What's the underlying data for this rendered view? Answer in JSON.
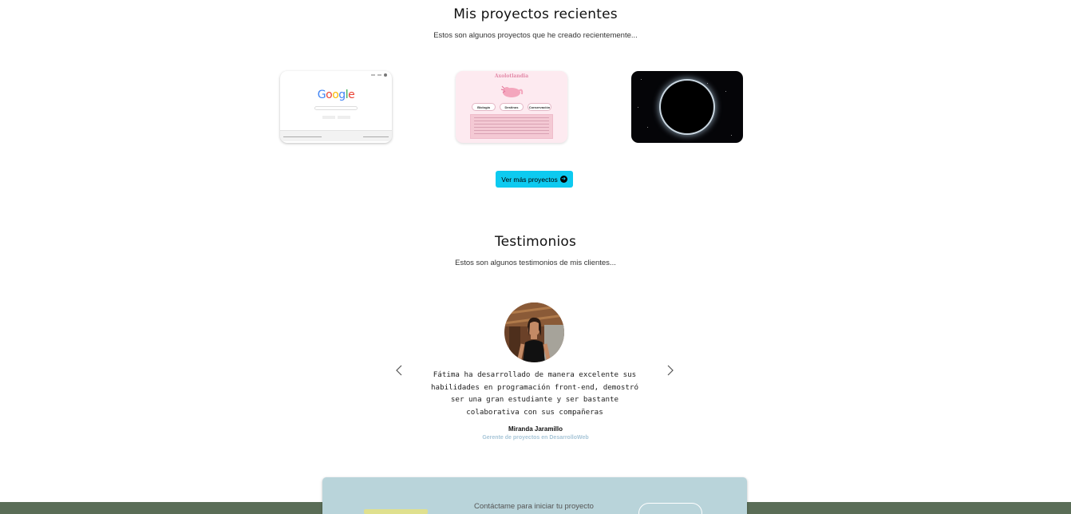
{
  "projects": {
    "title": "Mis proyectos recientes",
    "subtitle": "Estos son algunos proyectos que he creado recientemente...",
    "cards": [
      {
        "name": "google-clone",
        "logo_text": "Google"
      },
      {
        "name": "axolotl-site",
        "header_text": "Axolotlandia",
        "buttons": [
          "Biología",
          "Destinos",
          "Conservación"
        ]
      },
      {
        "name": "space-ring"
      }
    ],
    "more_button": "Ver más proyectos",
    "more_icon": "arrow-right-circle-icon"
  },
  "testimonials": {
    "title": "Testimonios",
    "subtitle": "Estos son algunos testimonios de mis clientes...",
    "quote": "Fátima ha desarrollado de manera excelente sus habilidades en programación front-end, demostró ser una gran estudiante y ser bastante colaborativa con sus compañeras",
    "client_name": "Miranda Jaramillo",
    "client_role": "Gerente de proyectos en DesarrolloWeb",
    "prev_icon": "chevron-left-icon",
    "next_icon": "chevron-right-icon"
  },
  "contact": {
    "text": "Contáctame para iniciar tu proyecto"
  },
  "colors": {
    "accent": "#0dcaf0",
    "footer": "#5a6d57",
    "contact_card": "#b9d4da",
    "role_text": "#a8c6d8"
  }
}
